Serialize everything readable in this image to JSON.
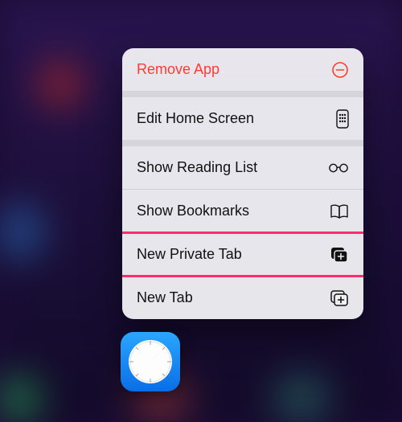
{
  "menu": {
    "remove_app": "Remove App",
    "edit_home_screen": "Edit Home Screen",
    "show_reading_list": "Show Reading List",
    "show_bookmarks": "Show Bookmarks",
    "new_private_tab": "New Private Tab",
    "new_tab": "New Tab"
  },
  "colors": {
    "destructive": "#ff3b30",
    "highlight": "#ff2d6b"
  },
  "highlighted_item": "new_private_tab",
  "app": "Safari"
}
